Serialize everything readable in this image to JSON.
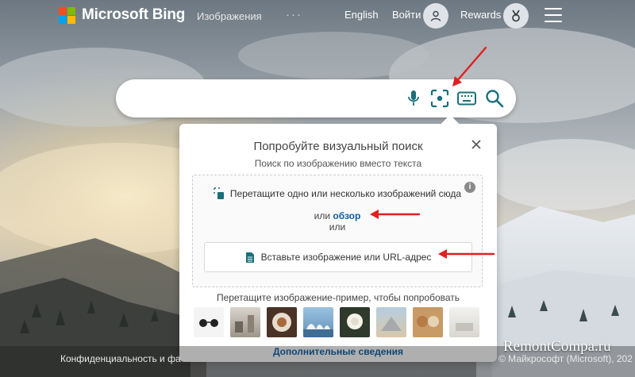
{
  "header": {
    "brand": "Microsoft Bing",
    "nav_images": "Изображения",
    "nav_more": "···",
    "language": "English",
    "signin": "Войти",
    "rewards": "Rewards",
    "icons": [
      "user-icon",
      "rewards-trophy-icon",
      "hamburger-menu-icon"
    ]
  },
  "search": {
    "value": "",
    "placeholder": "",
    "icons": [
      "microphone-icon",
      "visual-search-icon",
      "keyboard-icon",
      "search-icon"
    ]
  },
  "visual_search": {
    "title": "Попробуйте визуальный поиск",
    "subtitle": "Поиск по изображению вместо текста",
    "drag_text": "Перетащите одно или несколько изображений сюда",
    "or_label": "или",
    "browse_link": "обзор",
    "or_label2": "или",
    "paste_button": "Вставьте изображение или URL-адрес",
    "sample_label": "Перетащите изображение-пример, чтобы попробовать",
    "samples": [
      "sunglasses",
      "interior",
      "food-plate",
      "opera-house",
      "rose",
      "pyramid",
      "dogs",
      "room"
    ],
    "more_link": "Дополнительные сведения"
  },
  "footer": {
    "privacy": "Конфиденциальность и фа",
    "copyright": "© Майкрософт (Microsoft), 202"
  },
  "watermark": "RemontCompa.ru",
  "colors": {
    "link_blue": "#0b5fa5",
    "search_icon_teal": "#1a6f7a",
    "annotation_red": "#e02020",
    "logo_red": "#f25022",
    "logo_green": "#7fba00",
    "logo_blue": "#00a4ef",
    "logo_yellow": "#ffb900"
  }
}
